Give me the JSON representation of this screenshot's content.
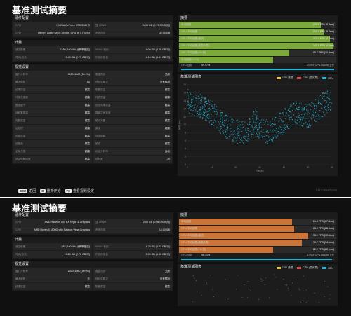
{
  "shot1": {
    "title": "基准测试摘要",
    "hardware": {
      "title": "硬件配置",
      "rows": [
        {
          "k": "GPU",
          "v": "NVIDIA GeForce RTX 2080 Ti"
        },
        {
          "k": "显 VRAM",
          "v": "11.00 GB (9.17 GB 可用)"
        },
        {
          "k": "CPU",
          "v": "Intel(R) Core(TM) i9-10900K CPU @ 3.70GHz"
        },
        {
          "k": "系统内存",
          "v": "32.00 GB"
        }
      ]
    },
    "compute": {
      "title": "计量",
      "rows": [
        {
          "k": "渲染像素",
          "v": "7180 (100.0% 分辨率缩放)"
        },
        {
          "k": "VRAM 使用",
          "v": "4.00 GB (4.29 GB 可)"
        },
        {
          "k": "时间(总共)",
          "v": "2.43 GB (2.73 GB 可)"
        },
        {
          "k": "内存使用量",
          "v": "4.16 GB (5.47 GB 可)"
        }
      ]
    },
    "settings": {
      "title": "视觉设置",
      "rows": [
        {
          "k": "窗口分辨率",
          "v": "1920x1080 (50.0%)"
        },
        {
          "k": "垂直同步",
          "v": "关闭"
        },
        {
          "k": "最大帧数",
          "v": "60"
        },
        {
          "k": "低延迟模式",
          "v": "没有限制"
        },
        {
          "k": "纹理质量",
          "v": "超高"
        },
        {
          "k": "阴影质量",
          "v": "超高"
        },
        {
          "k": "环境光遮蔽",
          "v": "超高"
        },
        {
          "k": "材质质量",
          "v": "超高"
        },
        {
          "k": "模型细节",
          "v": "超高"
        },
        {
          "k": "视觉效果质量",
          "v": "超高"
        },
        {
          "k": "体积雾质量",
          "v": "超高"
        },
        {
          "k": "屏幕空间反射",
          "v": "超高"
        },
        {
          "k": "光照质量",
          "v": "超高"
        },
        {
          "k": "镜头光晕",
          "v": "超高"
        },
        {
          "k": "后处理",
          "v": "超高"
        },
        {
          "k": "景深",
          "v": "超高"
        },
        {
          "k": "视距质量",
          "v": "超高"
        },
        {
          "k": "动态模糊",
          "v": "超高"
        },
        {
          "k": "反锯齿",
          "v": "超高"
        },
        {
          "k": "锐化",
          "v": "超高"
        },
        {
          "k": "全局光照",
          "v": "超高"
        },
        {
          "k": "动态分辨率",
          "v": "自动"
        },
        {
          "k": "运动模糊强度",
          "v": "超高"
        },
        {
          "k": "锐利度",
          "v": "15"
        }
      ]
    },
    "perf": {
      "title": "摘要",
      "bars": [
        {
          "label": "平均帧数",
          "value": "120.6 FPS (8.3ms)",
          "pct": 0.9,
          "color": "#8bbf3f"
        },
        {
          "label": "GPU 平均帧数",
          "value": "122.5 FPS (8.2ms)",
          "pct": 0.92,
          "color": "#8bbf3f"
        },
        {
          "label": "GPU 平均帧数(最快)",
          "value": "213.5 FPS (4.7ms)",
          "pct": 0.96,
          "color": "#8bbf3f"
        },
        {
          "label": "GPU 平均帧数(最高负载)",
          "value": "243.8 FPS (4.1ms)",
          "pct": 0.98,
          "color": "#8bbf3f"
        },
        {
          "label": "GPU 平均帧数(1% 低)",
          "value": "95.7 FPS (10.4ms)",
          "pct": 0.7,
          "color": "#8bbf3f"
        },
        {
          "label": "平均帧数(0.1%)",
          "value": "",
          "pct": 0.6,
          "color": "#8bbf3f"
        }
      ],
      "gpu": {
        "label": "GPU 限制",
        "pct": "99.97%",
        "bound": "0.03% CPU-Bound 工作",
        "fill": 0.9997
      }
    },
    "chart_title": "基准测试图表",
    "legend": [
      "CPU 受限",
      "CPU (高负载)",
      "GPU"
    ],
    "legend_colors": [
      "#e6c14a",
      "#e04a4a",
      "#1fb6d9"
    ],
    "footer": {
      "esc_key": "ESC",
      "esc_label": "返回",
      "c_key": "C",
      "c_label": "重新开始",
      "f2_key": "F2",
      "f2_label": "查看视频设定"
    },
    "watermark": "© FF © ShivaFT (x4.0)"
  },
  "chart_data": {
    "type": "scatter",
    "title": "基准测试图表",
    "xlabel": "时间 (秒)",
    "ylabel": "帧时 (ms)",
    "xlim": [
      0,
      60
    ],
    "ylim": [
      0,
      20
    ],
    "x_ticks": [
      0,
      10,
      20,
      30,
      40,
      50,
      60
    ],
    "y_ticks": [
      0,
      2,
      4,
      6,
      8,
      10,
      12,
      14,
      16,
      18,
      20
    ],
    "series": [
      {
        "name": "GPU",
        "color": "#1fb6d9",
        "trend": [
          [
            0,
            16
          ],
          [
            4,
            15
          ],
          [
            8,
            14
          ],
          [
            12,
            12
          ],
          [
            15,
            10
          ],
          [
            18,
            9
          ],
          [
            22,
            8
          ],
          [
            26,
            9
          ],
          [
            28,
            11
          ],
          [
            30,
            9
          ],
          [
            34,
            8
          ],
          [
            38,
            10
          ],
          [
            42,
            12
          ],
          [
            46,
            13
          ],
          [
            50,
            12
          ],
          [
            54,
            14
          ],
          [
            58,
            16
          ],
          [
            60,
            17
          ]
        ]
      }
    ]
  },
  "shot2": {
    "title": "基准测试摘要",
    "hardware": {
      "title": "硬件配置",
      "rows": [
        {
          "k": "GPU",
          "v": "AMD Radeon(TM) RX Vega 11 Graphics"
        },
        {
          "k": "显 VRAM",
          "v": "2.00 GB (0.08 GB 可用)"
        },
        {
          "k": "CPU",
          "v": "AMD Ryzen 5 3400G with Radeon Vega Graphics"
        },
        {
          "k": "系统内存",
          "v": "14.00 GB"
        }
      ]
    },
    "compute": {
      "title": "计量",
      "rows": [
        {
          "k": "渲染像素",
          "v": "882 (100.0% 分辨率缩放)"
        },
        {
          "k": "VRAM 使用",
          "v": "4.28 GB (5.73 GB 可)"
        },
        {
          "k": "时间(总共)",
          "v": "2.26 GB (2.78 GB 可)"
        },
        {
          "k": "内存使用量",
          "v": "5.99 GB (6.45 GB 可)"
        }
      ]
    },
    "settings": {
      "title": "视觉设置",
      "rows": [
        {
          "k": "窗口分辨率",
          "v": "1920x1080 (50.0%)"
        },
        {
          "k": "垂直同步",
          "v": "关闭"
        },
        {
          "k": "最大帧数",
          "v": "无"
        },
        {
          "k": "低延迟模式",
          "v": "没有限制"
        },
        {
          "k": "纹理质量",
          "v": "超高"
        },
        {
          "k": "阴影质量",
          "v": "超高"
        }
      ]
    },
    "perf": {
      "title": "摘要",
      "bars": [
        {
          "label": "平均帧数",
          "value": "14.8 FPS (67.4ms)",
          "pct": 0.72,
          "color": "#e6823a"
        },
        {
          "label": "GPU 平均帧数",
          "value": "15.0 FPS (66.5ms)",
          "pct": 0.73,
          "color": "#e6823a"
        },
        {
          "label": "GPU 平均帧数(最快)",
          "value": "95.1 FPS (10.5ms)",
          "pct": 0.82,
          "color": "#e6823a"
        },
        {
          "label": "GPU 平均帧数(最高负载)",
          "value": "70.7 FPS (14.1ms)",
          "pct": 0.78,
          "color": "#e6823a"
        },
        {
          "label": "GPU 平均帧数(1% 低)",
          "value": "12.2 FPS (82.1ms)",
          "pct": 0.6,
          "color": "#e6823a"
        }
      ],
      "gpu": {
        "label": "GPU 限制",
        "pct": "98.41%",
        "bound": "1.59% CPU-Bound 工作",
        "fill": 0.9841
      }
    },
    "chart_title": "基准测试图表",
    "legend": [
      "CPU 受限",
      "CPU (高负载)",
      "GPU"
    ],
    "legend_colors": [
      "#e6c14a",
      "#e04a4a",
      "#1fb6d9"
    ]
  }
}
